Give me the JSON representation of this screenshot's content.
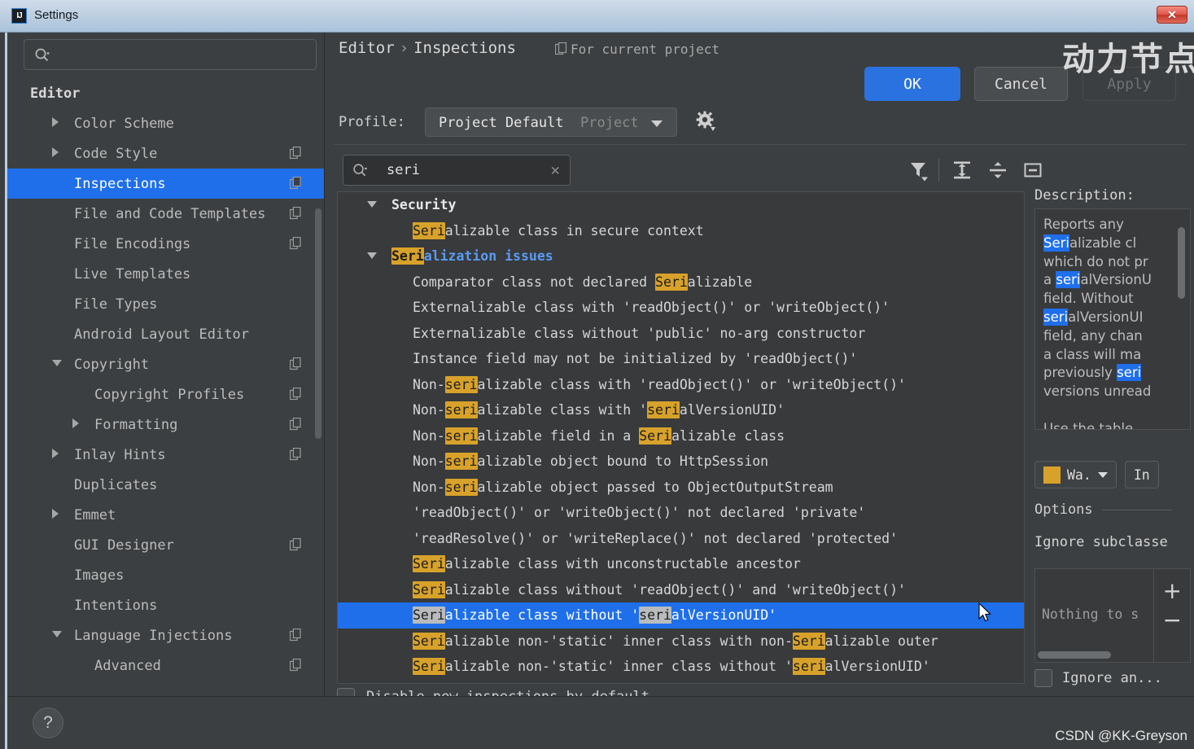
{
  "window": {
    "title": "Settings",
    "app_icon": "IJ",
    "close_label": "✕",
    "watermark_cn": "动力节点",
    "watermark_csdn": "CSDN @KK-Greyson"
  },
  "sidebar": {
    "search_placeholder": "",
    "items": [
      {
        "label": "Editor",
        "indent": 28,
        "arrow": "none",
        "bold": true,
        "copyicon": false,
        "selected": false
      },
      {
        "label": "Color Scheme",
        "indent": 82,
        "arrow": "right",
        "bold": false,
        "copyicon": false,
        "selected": false
      },
      {
        "label": "Code Style",
        "indent": 82,
        "arrow": "right",
        "bold": false,
        "copyicon": true,
        "selected": false
      },
      {
        "label": "Inspections",
        "indent": 82,
        "arrow": "none",
        "bold": false,
        "copyicon": true,
        "selected": true
      },
      {
        "label": "File and Code Templates",
        "indent": 82,
        "arrow": "none",
        "bold": false,
        "copyicon": true,
        "selected": false
      },
      {
        "label": "File Encodings",
        "indent": 82,
        "arrow": "none",
        "bold": false,
        "copyicon": true,
        "selected": false
      },
      {
        "label": "Live Templates",
        "indent": 82,
        "arrow": "none",
        "bold": false,
        "copyicon": false,
        "selected": false
      },
      {
        "label": "File Types",
        "indent": 82,
        "arrow": "none",
        "bold": false,
        "copyicon": false,
        "selected": false
      },
      {
        "label": "Android Layout Editor",
        "indent": 82,
        "arrow": "none",
        "bold": false,
        "copyicon": false,
        "selected": false
      },
      {
        "label": "Copyright",
        "indent": 82,
        "arrow": "down",
        "bold": false,
        "copyicon": true,
        "selected": false
      },
      {
        "label": "Copyright Profiles",
        "indent": 107,
        "arrow": "none",
        "bold": false,
        "copyicon": true,
        "selected": false
      },
      {
        "label": "Formatting",
        "indent": 107,
        "arrow": "right",
        "bold": false,
        "copyicon": true,
        "selected": false
      },
      {
        "label": "Inlay Hints",
        "indent": 82,
        "arrow": "right",
        "bold": false,
        "copyicon": true,
        "selected": false
      },
      {
        "label": "Duplicates",
        "indent": 82,
        "arrow": "none",
        "bold": false,
        "copyicon": false,
        "selected": false
      },
      {
        "label": "Emmet",
        "indent": 82,
        "arrow": "right",
        "bold": false,
        "copyicon": false,
        "selected": false
      },
      {
        "label": "GUI Designer",
        "indent": 82,
        "arrow": "none",
        "bold": false,
        "copyicon": true,
        "selected": false
      },
      {
        "label": "Images",
        "indent": 82,
        "arrow": "none",
        "bold": false,
        "copyicon": false,
        "selected": false
      },
      {
        "label": "Intentions",
        "indent": 82,
        "arrow": "none",
        "bold": false,
        "copyicon": false,
        "selected": false
      },
      {
        "label": "Language Injections",
        "indent": 82,
        "arrow": "down",
        "bold": false,
        "copyicon": true,
        "selected": false
      },
      {
        "label": "Advanced",
        "indent": 107,
        "arrow": "none",
        "bold": false,
        "copyicon": true,
        "selected": false
      }
    ]
  },
  "main": {
    "breadcrumb_root": "Editor",
    "breadcrumb_sep": "›",
    "breadcrumb_leaf": "Inspections",
    "scope_label": "For current project",
    "profile_label": "Profile:",
    "profile_value": "Project Default",
    "profile_modifier": "Project",
    "toolbar": {
      "search_value": "seri",
      "clear_label": "✕",
      "filter_icon": "filter-icon",
      "expand_all_icon": "expand-all-icon",
      "collapse_all_icon": "collapse-all-icon",
      "reset_icon": "reset-icon"
    },
    "disable_new_label": "Disable new inspections by default",
    "disable_new_checked": false
  },
  "tree": {
    "rows": [
      {
        "indent": 66,
        "arrow": "down",
        "group": true,
        "selected": false,
        "severity": false,
        "check": "none",
        "parts": [
          {
            "t": "Security",
            "h": false
          }
        ]
      },
      {
        "indent": 92,
        "arrow": "none",
        "group": false,
        "selected": false,
        "severity": false,
        "check": "none",
        "parts": [
          {
            "t": "Seri",
            "h": true
          },
          {
            "t": "alizable class in secure context",
            "h": false
          }
        ]
      },
      {
        "indent": 66,
        "arrow": "down",
        "group": true,
        "selected": false,
        "severity": true,
        "check": "partial",
        "parts": [
          {
            "t": "Seri",
            "h": true
          },
          {
            "t": "alization issues",
            "h": false,
            "link": true
          }
        ]
      },
      {
        "indent": 92,
        "arrow": "none",
        "group": false,
        "selected": false,
        "severity": false,
        "check": "none",
        "parts": [
          {
            "t": "Comparator class not declared ",
            "h": false
          },
          {
            "t": "Seri",
            "h": true
          },
          {
            "t": "alizable",
            "h": false
          }
        ]
      },
      {
        "indent": 92,
        "arrow": "none",
        "group": false,
        "selected": false,
        "severity": false,
        "check": "none",
        "parts": [
          {
            "t": "Externalizable class with 'readObject()' or 'writeObject()'",
            "h": false
          }
        ]
      },
      {
        "indent": 92,
        "arrow": "none",
        "group": false,
        "selected": false,
        "severity": true,
        "check": "checked",
        "parts": [
          {
            "t": "Externalizable class without 'public' no-arg constructor",
            "h": false
          }
        ]
      },
      {
        "indent": 92,
        "arrow": "none",
        "group": false,
        "selected": false,
        "severity": false,
        "check": "none",
        "parts": [
          {
            "t": "Instance field may not be initialized by 'readObject()'",
            "h": false
          }
        ]
      },
      {
        "indent": 92,
        "arrow": "none",
        "group": false,
        "selected": false,
        "severity": false,
        "check": "none",
        "parts": [
          {
            "t": "Non-",
            "h": false
          },
          {
            "t": "seri",
            "h": true
          },
          {
            "t": "alizable class with 'readObject()' or 'writeObject()'",
            "h": false
          }
        ]
      },
      {
        "indent": 92,
        "arrow": "none",
        "group": false,
        "selected": false,
        "severity": false,
        "check": "none",
        "parts": [
          {
            "t": "Non-",
            "h": false
          },
          {
            "t": "seri",
            "h": true
          },
          {
            "t": "alizable class with '",
            "h": false
          },
          {
            "t": "seri",
            "h": true
          },
          {
            "t": "alVersionUID'",
            "h": false
          }
        ]
      },
      {
        "indent": 92,
        "arrow": "none",
        "group": false,
        "selected": false,
        "severity": false,
        "check": "none",
        "parts": [
          {
            "t": "Non-",
            "h": false
          },
          {
            "t": "seri",
            "h": true
          },
          {
            "t": "alizable field in a ",
            "h": false
          },
          {
            "t": "Seri",
            "h": true
          },
          {
            "t": "alizable class",
            "h": false
          }
        ]
      },
      {
        "indent": 92,
        "arrow": "none",
        "group": false,
        "selected": false,
        "severity": false,
        "check": "none",
        "parts": [
          {
            "t": "Non-",
            "h": false
          },
          {
            "t": "seri",
            "h": true
          },
          {
            "t": "alizable object bound to HttpSession",
            "h": false
          }
        ]
      },
      {
        "indent": 92,
        "arrow": "none",
        "group": false,
        "selected": false,
        "severity": false,
        "check": "none",
        "parts": [
          {
            "t": "Non-",
            "h": false
          },
          {
            "t": "seri",
            "h": true
          },
          {
            "t": "alizable object passed to ObjectOutputStream",
            "h": false
          }
        ]
      },
      {
        "indent": 92,
        "arrow": "none",
        "group": false,
        "selected": false,
        "severity": false,
        "check": "none",
        "parts": [
          {
            "t": "'readObject()' or 'writeObject()' not declared 'private'",
            "h": false
          }
        ]
      },
      {
        "indent": 92,
        "arrow": "none",
        "group": false,
        "selected": false,
        "severity": false,
        "check": "none",
        "parts": [
          {
            "t": "'readResolve()' or 'writeReplace()' not declared 'protected'",
            "h": false
          }
        ]
      },
      {
        "indent": 92,
        "arrow": "none",
        "group": false,
        "selected": false,
        "severity": false,
        "check": "none",
        "parts": [
          {
            "t": "Seri",
            "h": true
          },
          {
            "t": "alizable class with unconstructable ancestor",
            "h": false
          }
        ]
      },
      {
        "indent": 92,
        "arrow": "none",
        "group": false,
        "selected": false,
        "severity": false,
        "check": "none",
        "parts": [
          {
            "t": "Seri",
            "h": true
          },
          {
            "t": "alizable class without 'readObject()' and 'writeObject()'",
            "h": false
          }
        ]
      },
      {
        "indent": 92,
        "arrow": "none",
        "group": false,
        "selected": true,
        "severity": true,
        "check": "checked",
        "parts": [
          {
            "t": "Seri",
            "h": true
          },
          {
            "t": "alizable class without '",
            "h": false
          },
          {
            "t": "seri",
            "h": true
          },
          {
            "t": "alVersionUID'",
            "h": false
          }
        ]
      },
      {
        "indent": 92,
        "arrow": "none",
        "group": false,
        "selected": false,
        "severity": false,
        "check": "none",
        "parts": [
          {
            "t": "Seri",
            "h": true
          },
          {
            "t": "alizable non-'static' inner class with non-",
            "h": false
          },
          {
            "t": "Seri",
            "h": true
          },
          {
            "t": "alizable outer",
            "h": false
          }
        ]
      },
      {
        "indent": 92,
        "arrow": "none",
        "group": false,
        "selected": false,
        "severity": false,
        "check": "none",
        "parts": [
          {
            "t": "Seri",
            "h": true
          },
          {
            "t": "alizable non-'static' inner class without '",
            "h": false
          },
          {
            "t": "seri",
            "h": true
          },
          {
            "t": "alVersionUID'",
            "h": false
          }
        ]
      }
    ]
  },
  "description": {
    "title": "Description:",
    "lines": [
      [
        {
          "t": "Reports any",
          "h": false
        }
      ],
      [
        {
          "t": "Seri",
          "h": true
        },
        {
          "t": "alizable cl",
          "h": false
        }
      ],
      [
        {
          "t": "which do not pr",
          "h": false
        }
      ],
      [
        {
          "t": "a ",
          "h": false
        },
        {
          "t": "seri",
          "h": true
        },
        {
          "t": "alVersionU",
          "h": false
        }
      ],
      [
        {
          "t": "field. Without ",
          "h": false
        }
      ],
      [
        {
          "t": "seri",
          "h": true
        },
        {
          "t": "alVersionUI",
          "h": false
        }
      ],
      [
        {
          "t": "field, any chan",
          "h": false
        }
      ],
      [
        {
          "t": "a class will ma",
          "h": false
        }
      ],
      [
        {
          "t": "previously ",
          "h": false
        },
        {
          "t": "seri",
          "h": true
        }
      ],
      [
        {
          "t": "versions unread",
          "h": false
        }
      ],
      [
        {
          "t": "",
          "h": false
        }
      ],
      [
        {
          "t": "Use the table",
          "h": false
        }
      ]
    ],
    "severity_button_label": "Wa.",
    "scope_button_label": "In",
    "options_header": "Options",
    "option_label": "Ignore subclasse",
    "list_empty_text": "Nothing to s",
    "add_label": "+",
    "remove_label": "−",
    "ignore_anonymous_label": "Ignore an...",
    "ignore_anonymous_checked": false
  },
  "footer": {
    "help_label": "?",
    "ok_label": "OK",
    "cancel_label": "Cancel",
    "apply_label": "Apply"
  }
}
